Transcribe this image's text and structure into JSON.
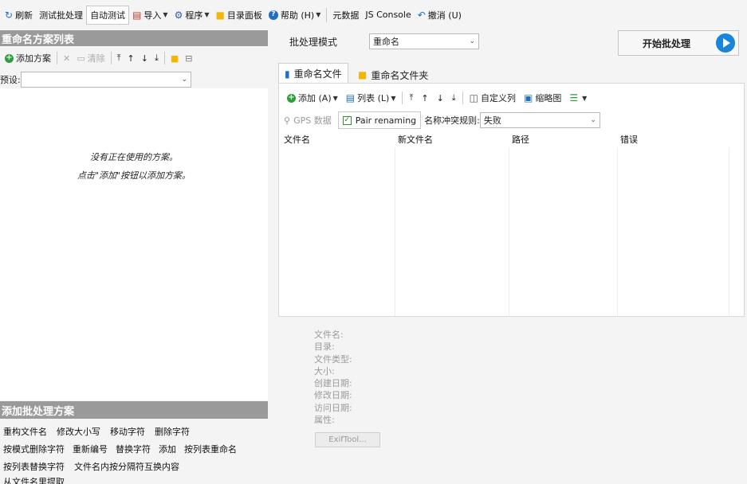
{
  "toolbar": {
    "items": [
      {
        "icon": "↻",
        "label": "刷新"
      },
      {
        "icon": "",
        "label": "测试批处理"
      },
      {
        "icon": "",
        "label": "自动测试"
      },
      {
        "icon": "▤",
        "label": "导入"
      },
      {
        "icon": "⚙",
        "label": "程序"
      },
      {
        "icon": "■",
        "label": "目录面板"
      },
      {
        "icon": "?",
        "label": "帮助 (H)"
      },
      {
        "icon": "",
        "label": "元数据"
      },
      {
        "icon": "",
        "label": "JS Console"
      },
      {
        "icon": "↶",
        "label": "撤消 (U)"
      }
    ]
  },
  "left": {
    "list_header": "重命名方案列表",
    "tools": {
      "add": "添加方案",
      "clear": "清除"
    },
    "preset_label": "预设:",
    "preset_value": "",
    "empty_line1": "没有正在使用的方案。",
    "empty_line2": "点击\"添加\"按钮以添加方案。",
    "add_header": "添加批处理方案",
    "actions": [
      [
        "重构文件名",
        "修改大小写",
        "移动字符",
        "删除字符"
      ],
      [
        "按模式删除字符",
        "重新编号",
        "替换字符",
        "添加",
        "按列表重命名"
      ],
      [
        "按列表替换字符",
        "文件名内按分隔符互换内容"
      ],
      [
        "从文件名里提取"
      ]
    ]
  },
  "right": {
    "batch_mode_label": "批处理模式",
    "batch_mode_value": "重命名",
    "start_button": "开始批处理",
    "tabs": [
      "重命名文件",
      "重命名文件夹"
    ],
    "tools": {
      "add": "添加 (A)",
      "list": "列表 (L)",
      "custom_columns": "自定义列",
      "thumbnails": "缩略图"
    },
    "gps": "GPS 数据",
    "pair_renaming": "Pair renaming",
    "conflict_label": "名称冲突规则:",
    "conflict_value": "失败",
    "columns": [
      "文件名",
      "新文件名",
      "路径",
      "错误"
    ],
    "properties": [
      "文件名:",
      "目录:",
      "文件类型:",
      "大小:",
      "创建日期:",
      "修改日期:",
      "访问日期:",
      "属性:"
    ],
    "exif_button": "ExifTool..."
  },
  "colors": {
    "header_bg": "#9a9a9a",
    "accent": "#1a84d8",
    "add_green": "#2e9e3a",
    "folder_yellow": "#f2b705"
  }
}
